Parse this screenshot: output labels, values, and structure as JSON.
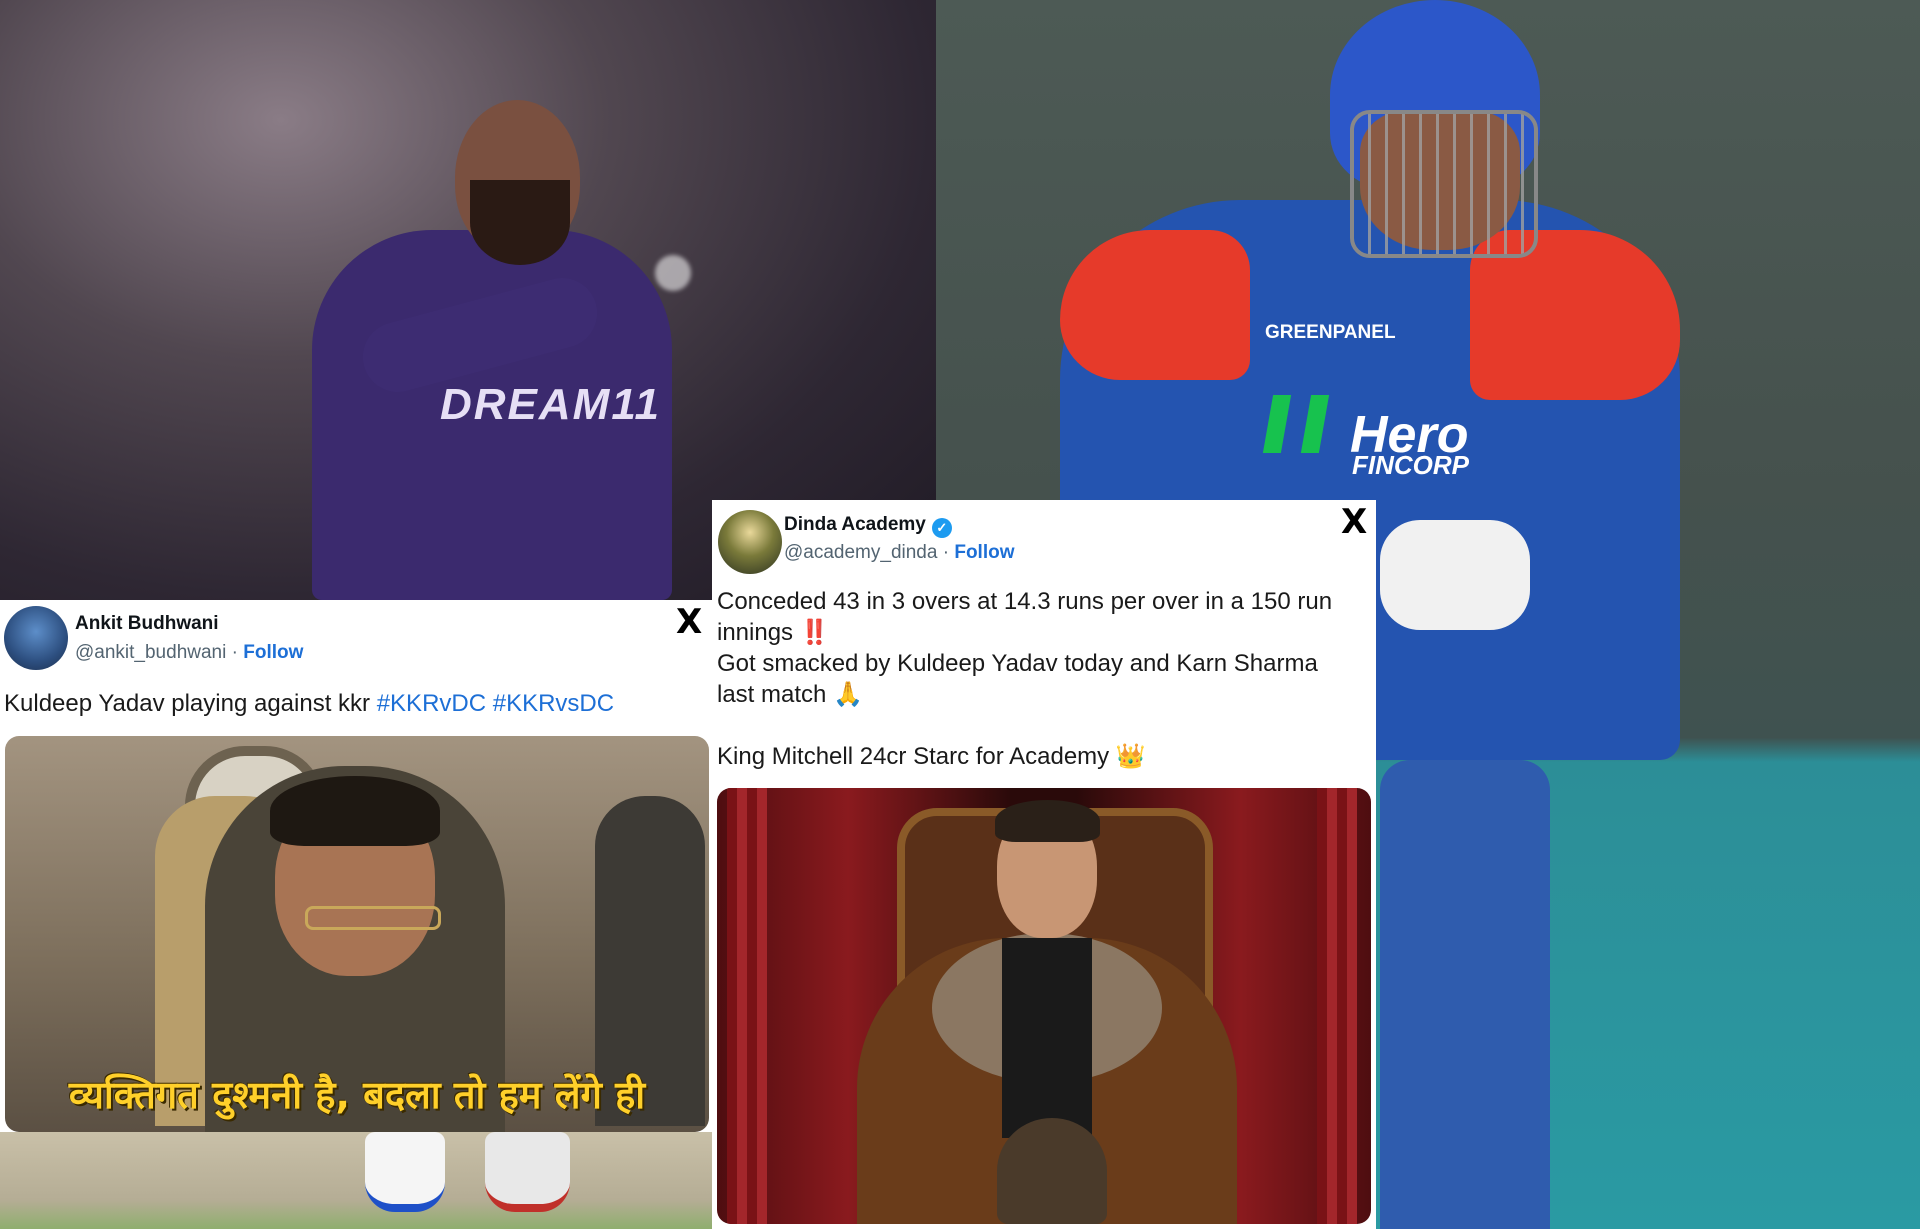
{
  "left_photo": {
    "jersey_text": "DREAM11"
  },
  "right_photo": {
    "sponsor_1": "Hero",
    "sponsor_2": "FINCORP",
    "sponsor_3": "GREENPANEL"
  },
  "tweet_left": {
    "name": "Ankit Budhwani",
    "handle": "@ankit_budhwani",
    "separator": " · ",
    "follow": "Follow",
    "text_plain": "Kuldeep Yadav playing against kkr ",
    "hashtag_1": "#KKRvDC",
    "hashtag_2": "#KKRvsDC",
    "meme_caption": "व्यक्तिगत दुश्मनी है, बदला तो हम लेंगे ही",
    "x_logo": "X"
  },
  "tweet_mid": {
    "name": "Dinda Academy",
    "verified": "✓",
    "handle": "@academy_dinda",
    "separator": " · ",
    "follow": "Follow",
    "line_1": "Conceded 43 in 3 overs at 14.3 runs per over in a 150 run",
    "line_2": "innings ‼️",
    "line_3": "Got smacked by Kuldeep Yadav today and Karn Sharma",
    "line_4": "last match 🙏",
    "line_5": "King Mitchell 24cr Starc for Academy  👑",
    "x_logo": "X"
  },
  "colors": {
    "link_blue": "#1d6fd6",
    "caption_yellow": "#ffd02a",
    "kkr_purple": "#3b2a6e",
    "dc_blue": "#2454b0",
    "dc_red": "#e63a2a"
  }
}
